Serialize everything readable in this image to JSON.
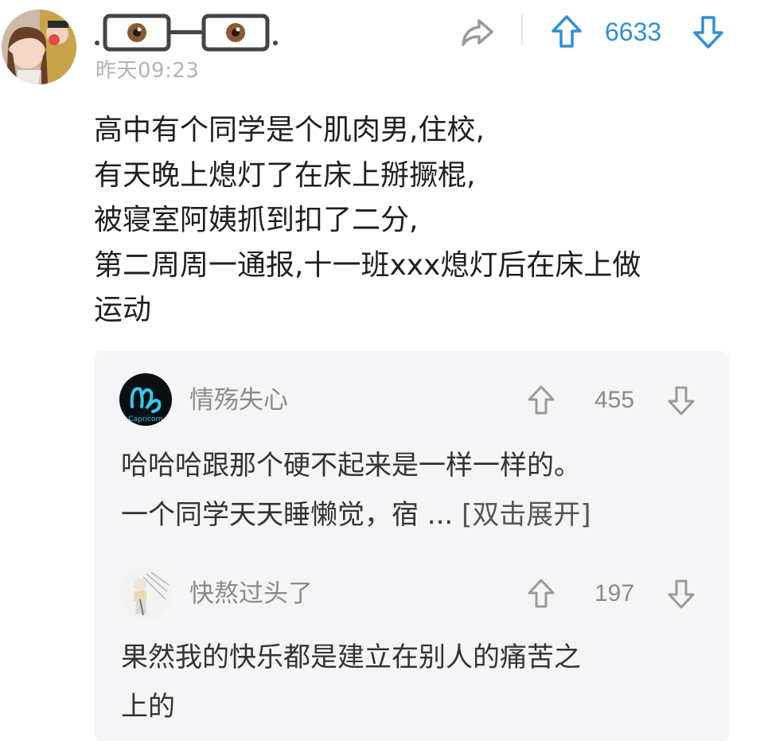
{
  "post": {
    "username_display": ".OO—OO.",
    "timestamp": "昨天09:23",
    "votes": "6633",
    "lines": [
      "高中有个同学是个肌肉男,住校,",
      "有天晚上熄灯了在床上掰撅棍,",
      "被寝室阿姨抓到扣了二分,",
      "第二周周一通报,十一班xxx熄灯后在床上做",
      "运动"
    ]
  },
  "comments": [
    {
      "name": "情殇失心",
      "votes": "455",
      "line1": "哈哈哈跟那个硬不起来是一样一样的。",
      "line2": "一个同学天天睡懒觉，宿 ... ",
      "expand": "[双击展开]",
      "avatar_text": "Capricorn"
    },
    {
      "name": "快熬过头了",
      "votes": "197",
      "line1": "果然我的快乐都是建立在别人的痛苦之",
      "line2": "上的"
    }
  ],
  "icons": {
    "share": "share-icon",
    "up": "arrow-up-icon",
    "down": "arrow-down-icon"
  },
  "colors": {
    "accent": "#2e8fd9",
    "muted": "#8a8a8a",
    "comment_bg": "#f5f5f7"
  }
}
